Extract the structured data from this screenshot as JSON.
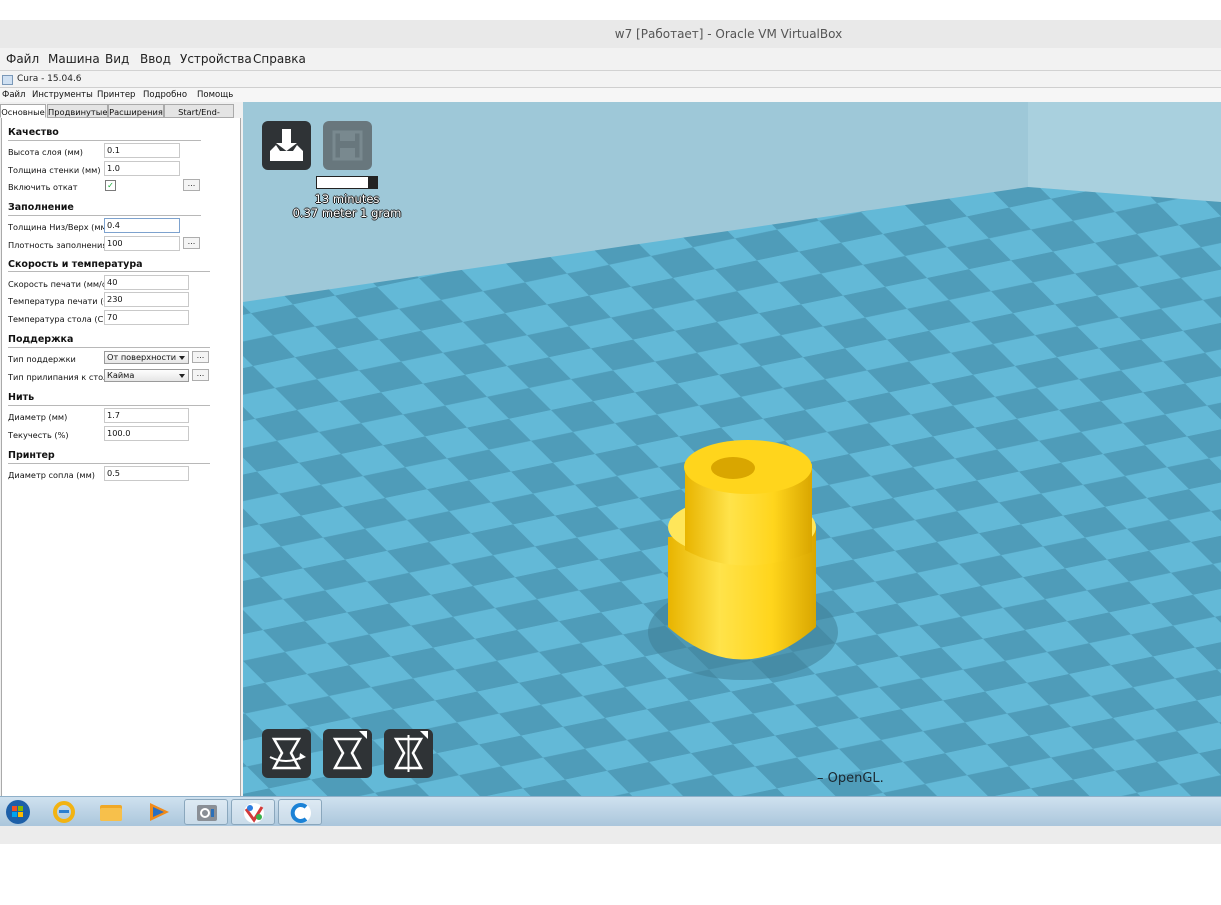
{
  "host": {
    "title": "w7 [Работает] - Oracle VM VirtualBox",
    "menu": [
      "Файл",
      "Машина",
      "Вид",
      "Ввод",
      "Устройства",
      "Справка"
    ]
  },
  "cura": {
    "title": "Cura - 15.04.6",
    "menu": [
      "Файл",
      "Инструменты",
      "Принтер",
      "Подробно",
      "Помощь"
    ],
    "tabs": [
      "Основные",
      "Продвинутые",
      "Расширения",
      "Start/End-GCode"
    ],
    "active_tab": "Основные"
  },
  "settings": {
    "quality": {
      "title": "Качество",
      "layer_height_label": "Высота слоя (мм)",
      "layer_height": "0.1",
      "shell_label": "Толщина стенки (мм)",
      "shell": "1.0",
      "retraction_label": "Включить откат",
      "retraction": "✓",
      "more": "..."
    },
    "fill": {
      "title": "Заполнение",
      "bottom_top_label": "Толщина Низ/Верх (мм)",
      "bottom_top": "0.4",
      "density_label": "Плотность заполнения",
      "density": "100",
      "more": "..."
    },
    "speed": {
      "title": "Скорость и температура",
      "print_speed_label": "Скорость печати (мм/с)",
      "print_speed": "40",
      "print_temp_label": "Температура печати (C)",
      "print_temp": "230",
      "bed_temp_label": "Температура стола (C)",
      "bed_temp": "70"
    },
    "support": {
      "title": "Поддержка",
      "type_label": "Тип поддержки",
      "type": "От поверхности",
      "adhesion_label": "Тип прилипания к столу",
      "adhesion": "Кайма",
      "more": "..."
    },
    "filament": {
      "title": "Нить",
      "diameter_label": "Диаметр (мм)",
      "diameter": "1.7",
      "flow_label": "Текучесть (%)",
      "flow": "100.0"
    },
    "machine": {
      "title": "Принтер",
      "nozzle_label": "Диаметр сопла (мм)",
      "nozzle": "0.5"
    }
  },
  "viewport": {
    "print_time": "13 minutes",
    "print_material": "0.37 meter 1 gram",
    "progress": 0.15,
    "renderer": "–    OpenGL.",
    "colors": {
      "model": "#ffd51c",
      "bed_light": "#63b9d7",
      "bed_dark": "#4f9cb9",
      "wall": "#9ec8d8"
    },
    "icons": [
      "load-model-icon",
      "save-toolpath-icon",
      "rotate-icon",
      "scale-icon",
      "mirror-icon"
    ]
  },
  "taskbar": {
    "items": [
      "start-orb-icon",
      "internet-explorer-icon",
      "file-explorer-icon",
      "media-player-icon",
      "control-panel-icon",
      "paint-icon",
      "cura-app-icon"
    ],
    "active": [
      "control-panel-icon",
      "paint-icon",
      "cura-app-icon"
    ]
  }
}
